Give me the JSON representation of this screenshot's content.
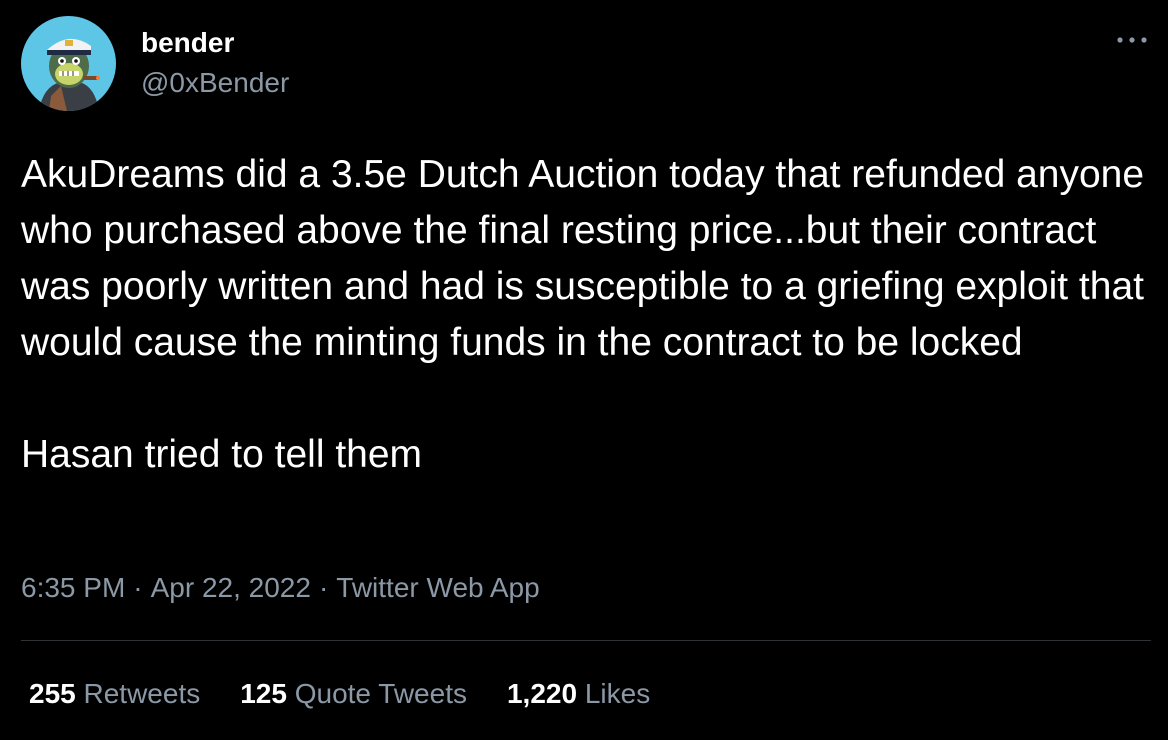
{
  "author": {
    "display_name": "bender",
    "handle": "@0xBender",
    "avatar_icon": "ape-avatar-icon"
  },
  "more_icon": "more-horizontal-icon",
  "tweet": {
    "paragraphs": [
      "AkuDreams did a 3.5e Dutch Auction today that refunded anyone who purchased above the final resting price...but their contract was poorly written and had is susceptible to a griefing exploit that would cause the minting funds in the contract to be locked",
      "Hasan tried to tell them"
    ]
  },
  "meta": {
    "time": "6:35 PM",
    "separator": "·",
    "date": "Apr 22, 2022",
    "source": "Twitter Web App"
  },
  "stats": {
    "retweets_count": "255",
    "retweets_label": "Retweets",
    "quotes_count": "125",
    "quotes_label": "Quote Tweets",
    "likes_count": "1,220",
    "likes_label": "Likes"
  },
  "colors": {
    "background": "#000000",
    "text": "#ffffff",
    "secondary_text": "#8b98a5",
    "divider": "#2f3336",
    "avatar_bg": "#5dc6e6"
  }
}
